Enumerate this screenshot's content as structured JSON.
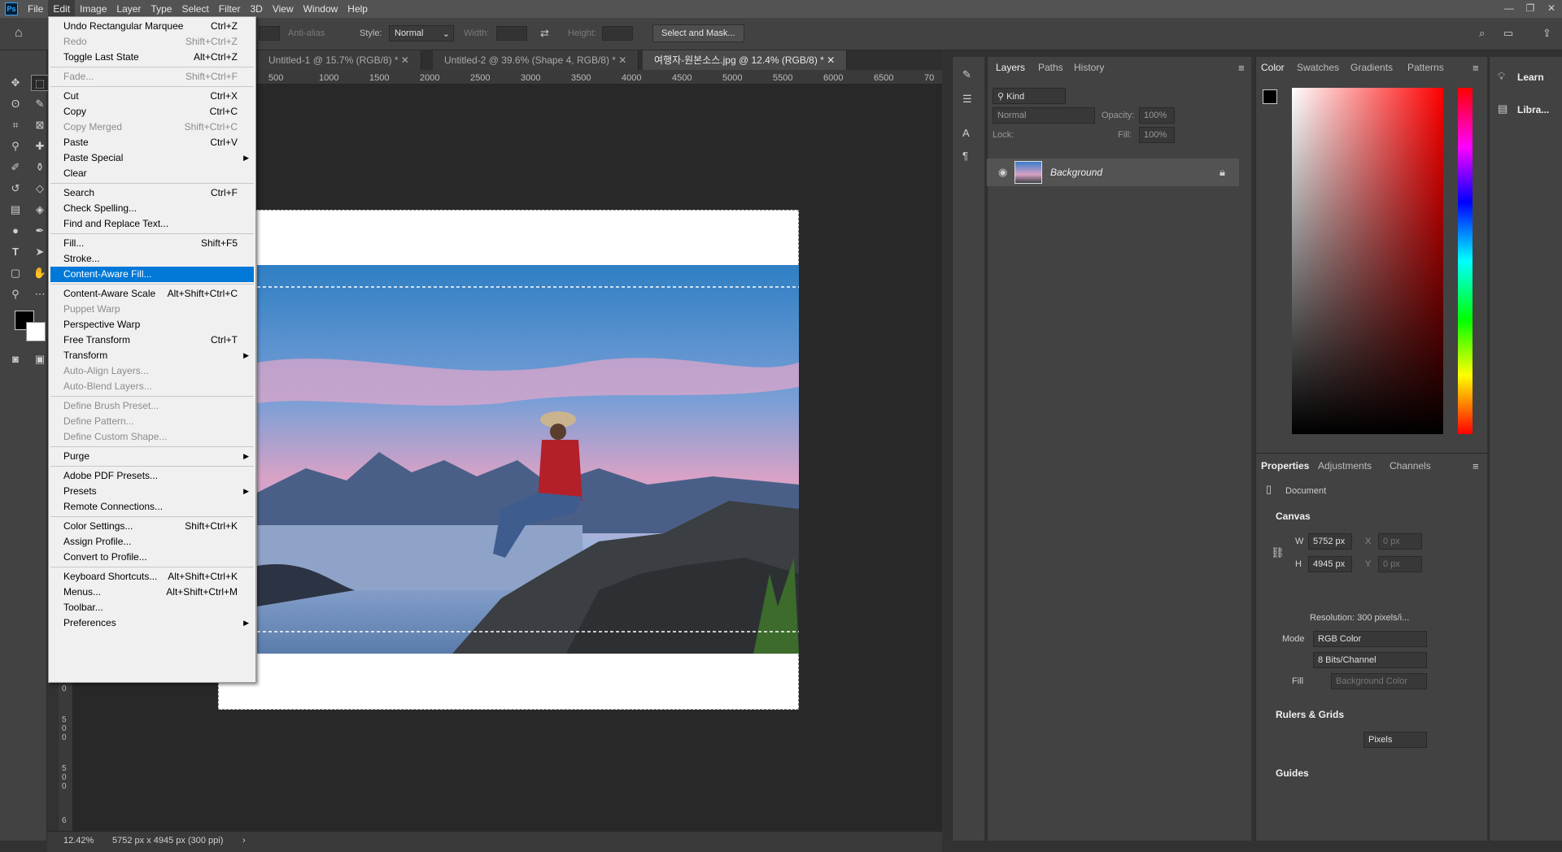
{
  "menubar": {
    "logo": "Ps",
    "items": [
      "File",
      "Edit",
      "Image",
      "Layer",
      "Type",
      "Select",
      "Filter",
      "3D",
      "View",
      "Window",
      "Help"
    ]
  },
  "options": {
    "anti_alias": "Anti-alias",
    "style_label": "Style:",
    "style_value": "Normal",
    "width_label": "Width:",
    "height_label": "Height:",
    "select_mask": "Select and Mask..."
  },
  "tabs": [
    "Untitled-1 @ 15.7% (RGB/8) *",
    "Untitled-2 @ 39.6% (Shape 4, RGB/8) *",
    "여행자-원본소스.jpg @ 12.4% (RGB/8) *"
  ],
  "ruler_ticks": [
    "500",
    "1000",
    "1500",
    "2000",
    "2500",
    "3000",
    "3500",
    "4000",
    "4500",
    "5000",
    "5500",
    "6000",
    "6500",
    "70"
  ],
  "vruler_ticks": [
    "0",
    "500",
    "500",
    "6"
  ],
  "status": {
    "zoom": "12.42%",
    "doc_info": "5752 px x 4945 px (300 ppi)"
  },
  "edit_menu": [
    {
      "label": "Undo Rectangular Marquee",
      "shortcut": "Ctrl+Z",
      "disabled": false
    },
    {
      "label": "Redo",
      "shortcut": "Shift+Ctrl+Z",
      "disabled": true
    },
    {
      "label": "Toggle Last State",
      "shortcut": "Alt+Ctrl+Z",
      "disabled": false
    },
    {
      "sep": true
    },
    {
      "label": "Fade...",
      "shortcut": "Shift+Ctrl+F",
      "disabled": true
    },
    {
      "sep": true
    },
    {
      "label": "Cut",
      "shortcut": "Ctrl+X",
      "disabled": false
    },
    {
      "label": "Copy",
      "shortcut": "Ctrl+C",
      "disabled": false
    },
    {
      "label": "Copy Merged",
      "shortcut": "Shift+Ctrl+C",
      "disabled": true
    },
    {
      "label": "Paste",
      "shortcut": "Ctrl+V",
      "disabled": false
    },
    {
      "label": "Paste Special",
      "submenu": true,
      "disabled": false
    },
    {
      "label": "Clear",
      "disabled": false
    },
    {
      "sep": true
    },
    {
      "label": "Search",
      "shortcut": "Ctrl+F",
      "disabled": false
    },
    {
      "label": "Check Spelling...",
      "disabled": false
    },
    {
      "label": "Find and Replace Text...",
      "disabled": false
    },
    {
      "sep": true
    },
    {
      "label": "Fill...",
      "shortcut": "Shift+F5",
      "disabled": false
    },
    {
      "label": "Stroke...",
      "disabled": false
    },
    {
      "label": "Content-Aware Fill...",
      "disabled": false,
      "highlight": true
    },
    {
      "sep": true
    },
    {
      "label": "Content-Aware Scale",
      "shortcut": "Alt+Shift+Ctrl+C",
      "disabled": false
    },
    {
      "label": "Puppet Warp",
      "disabled": true
    },
    {
      "label": "Perspective Warp",
      "disabled": false
    },
    {
      "label": "Free Transform",
      "shortcut": "Ctrl+T",
      "disabled": false
    },
    {
      "label": "Transform",
      "submenu": true,
      "disabled": false
    },
    {
      "label": "Auto-Align Layers...",
      "disabled": true
    },
    {
      "label": "Auto-Blend Layers...",
      "disabled": true
    },
    {
      "sep": true
    },
    {
      "label": "Define Brush Preset...",
      "disabled": true
    },
    {
      "label": "Define Pattern...",
      "disabled": true
    },
    {
      "label": "Define Custom Shape...",
      "disabled": true
    },
    {
      "sep": true
    },
    {
      "label": "Purge",
      "submenu": true,
      "disabled": false
    },
    {
      "sep": true
    },
    {
      "label": "Adobe PDF Presets...",
      "disabled": false
    },
    {
      "label": "Presets",
      "submenu": true,
      "disabled": false
    },
    {
      "label": "Remote Connections...",
      "disabled": false
    },
    {
      "sep": true
    },
    {
      "label": "Color Settings...",
      "shortcut": "Shift+Ctrl+K",
      "disabled": false
    },
    {
      "label": "Assign Profile...",
      "disabled": false
    },
    {
      "label": "Convert to Profile...",
      "disabled": false
    },
    {
      "sep": true
    },
    {
      "label": "Keyboard Shortcuts...",
      "shortcut": "Alt+Shift+Ctrl+K",
      "disabled": false
    },
    {
      "label": "Menus...",
      "shortcut": "Alt+Shift+Ctrl+M",
      "disabled": false
    },
    {
      "label": "Toolbar...",
      "disabled": false
    },
    {
      "label": "Preferences",
      "submenu": true,
      "disabled": false
    }
  ],
  "layers_panel": {
    "tabs": [
      "Layers",
      "Paths",
      "History"
    ],
    "kind": "Kind",
    "blend": "Normal",
    "opacity_label": "Opacity:",
    "opacity_value": "100%",
    "lock_label": "Lock:",
    "fill_label": "Fill:",
    "fill_value": "100%",
    "layer_name": "Background"
  },
  "color_panel": {
    "tabs": [
      "Color",
      "Swatches",
      "Gradients",
      "Patterns"
    ]
  },
  "right_dock": {
    "learn": "Learn",
    "libraries": "Libra..."
  },
  "properties": {
    "tabs": [
      "Properties",
      "Adjustments",
      "Channels"
    ],
    "document": "Document",
    "canvas": "Canvas",
    "w_label": "W",
    "w_value": "5752 px",
    "h_label": "H",
    "h_value": "4945 px",
    "x_label": "X",
    "x_value": "0 px",
    "y_label": "Y",
    "y_value": "0 px",
    "resolution": "Resolution: 300 pixels/i...",
    "mode_label": "Mode",
    "mode_value": "RGB Color",
    "bits_value": "8 Bits/Channel",
    "fill_label": "Fill",
    "fill_value": "Background Color",
    "rulers": "Rulers & Grids",
    "units": "Pixels",
    "guides": "Guides"
  }
}
